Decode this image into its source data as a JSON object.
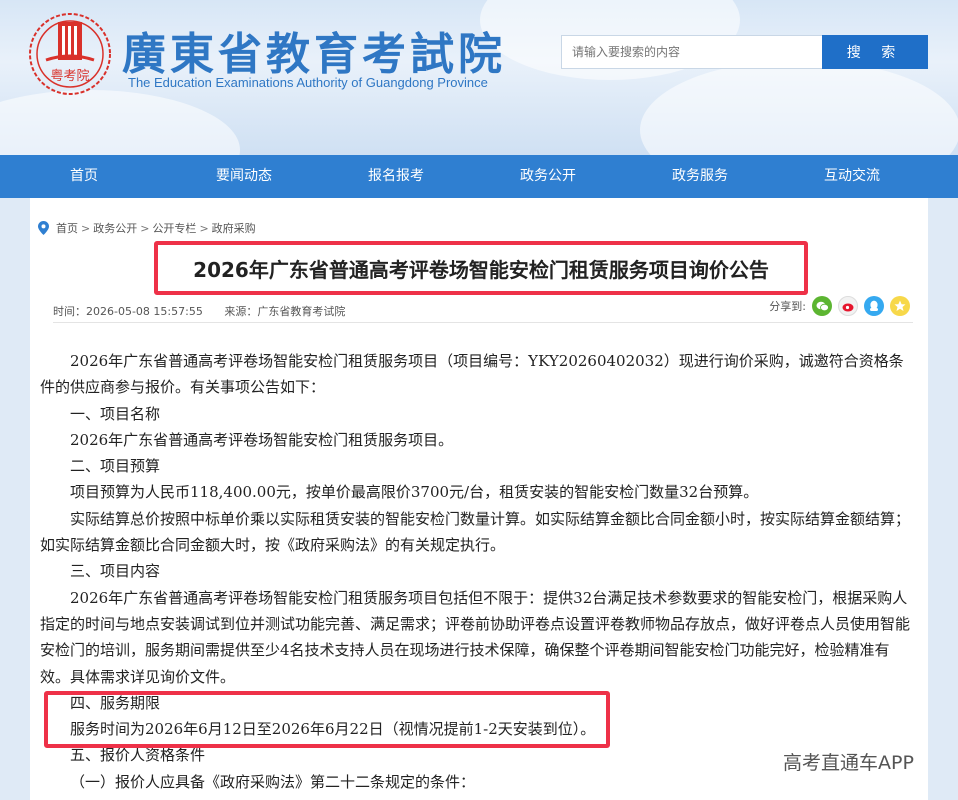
{
  "header": {
    "seal_text": "粤考院",
    "title": "廣東省教育考試院",
    "subtitle": "The Education Examinations Authority of Guangdong Province",
    "search_placeholder": "请输入要搜索的内容",
    "search_button": "搜 索"
  },
  "nav": [
    "首页",
    "要闻动态",
    "报名报考",
    "政务公开",
    "政务服务",
    "互动交流"
  ],
  "breadcrumb": [
    "首页",
    "政务公开",
    "公开专栏",
    "政府采购"
  ],
  "article": {
    "title": "2026年广东省普通高考评卷场智能安检门租赁服务项目询价公告",
    "time": "时间：2026-05-08 15:57:55",
    "source": "来源：广东省教育考试院",
    "share_label": "分享到:",
    "paragraphs": [
      {
        "cls": "indent",
        "text": "2026年广东省普通高考评卷场智能安检门租赁服务项目（项目编号：YKY20260402032）现进行询价采购，诚邀符合资格条件的供应商参与报价。有关事项公告如下："
      },
      {
        "cls": "head",
        "text": "一、项目名称"
      },
      {
        "cls": "head",
        "text": "2026年广东省普通高考评卷场智能安检门租赁服务项目。"
      },
      {
        "cls": "head",
        "text": "二、项目预算"
      },
      {
        "cls": "indent",
        "text": "项目预算为人民币118,400.00元，按单价最高限价3700元/台，租赁安装的智能安检门数量32台预算。"
      },
      {
        "cls": "indent",
        "text": "实际结算总价按照中标单价乘以实际租赁安装的智能安检门数量计算。如实际结算金额比合同金额小时，按实际结算金额结算；如实际结算金额比合同金额大时，按《政府采购法》的有关规定执行。"
      },
      {
        "cls": "head",
        "text": "三、项目内容"
      },
      {
        "cls": "indent",
        "text": "2026年广东省普通高考评卷场智能安检门租赁服务项目包括但不限于：提供32台满足技术参数要求的智能安检门，根据采购人指定的时间与地点安装调试到位并测试功能完善、满足需求；评卷前协助评卷点设置评卷教师物品存放点，做好评卷点人员使用智能安检门的培训，服务期间需提供至少4名技术支持人员在现场进行技术保障，确保整个评卷期间智能安检门功能完好，检验精准有效。具体需求详见询价文件。"
      },
      {
        "cls": "head",
        "text": "四、服务期限"
      },
      {
        "cls": "head",
        "text": "服务时间为2026年6月12日至2026年6月22日（视情况提前1-2天安装到位）。"
      },
      {
        "cls": "head",
        "text": "五、报价人资格条件"
      },
      {
        "cls": "head",
        "text": "（一）报价人应具备《政府采购法》第二十二条规定的条件："
      }
    ]
  },
  "watermark": "高考直通车APP",
  "colors": {
    "nav": "#2f7fd1",
    "button": "#1f6fc8",
    "highlight": "#ee3148",
    "logo": "#2f77c4"
  }
}
